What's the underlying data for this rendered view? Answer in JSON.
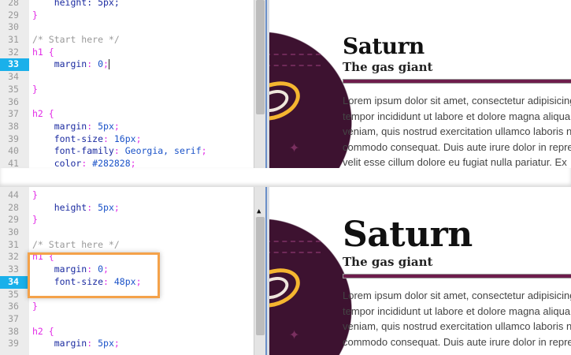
{
  "top": {
    "lines": [
      {
        "num": "28",
        "tokens": [
          {
            "t": "    height: 5px;",
            "c": "prop"
          }
        ]
      },
      {
        "num": "29",
        "tokens": [
          {
            "t": "}",
            "c": "punct"
          }
        ]
      },
      {
        "num": "30",
        "tokens": []
      },
      {
        "num": "31",
        "tokens": [
          {
            "t": "/* Start here */",
            "c": "com"
          }
        ]
      },
      {
        "num": "32",
        "tokens": [
          {
            "t": "h1 {",
            "c": "sel"
          }
        ]
      },
      {
        "num": "33",
        "active": true,
        "caret": true,
        "tokens": [
          {
            "t": "    margin",
            "c": "prop"
          },
          {
            "t": ": ",
            "c": "punct"
          },
          {
            "t": "0",
            "c": "val"
          },
          {
            "t": ";",
            "c": "punct"
          }
        ]
      },
      {
        "num": "34",
        "tokens": []
      },
      {
        "num": "35",
        "tokens": [
          {
            "t": "}",
            "c": "punct"
          }
        ]
      },
      {
        "num": "36",
        "tokens": []
      },
      {
        "num": "37",
        "tokens": [
          {
            "t": "h2 {",
            "c": "sel"
          }
        ]
      },
      {
        "num": "38",
        "tokens": [
          {
            "t": "    margin",
            "c": "prop"
          },
          {
            "t": ": ",
            "c": "punct"
          },
          {
            "t": "5px",
            "c": "val"
          },
          {
            "t": ";",
            "c": "punct"
          }
        ]
      },
      {
        "num": "39",
        "tokens": [
          {
            "t": "    font-size",
            "c": "prop"
          },
          {
            "t": ": ",
            "c": "punct"
          },
          {
            "t": "16px",
            "c": "val"
          },
          {
            "t": ";",
            "c": "punct"
          }
        ]
      },
      {
        "num": "40",
        "tokens": [
          {
            "t": "    font-family",
            "c": "prop"
          },
          {
            "t": ": ",
            "c": "punct"
          },
          {
            "t": "Georgia, serif",
            "c": "val"
          },
          {
            "t": ";",
            "c": "punct"
          }
        ]
      },
      {
        "num": "41",
        "tokens": [
          {
            "t": "    color",
            "c": "prop"
          },
          {
            "t": ": ",
            "c": "punct"
          },
          {
            "t": "#282828",
            "c": "val"
          },
          {
            "t": ";",
            "c": "punct"
          }
        ]
      }
    ]
  },
  "bottom": {
    "lines": [
      {
        "num": "44",
        "tokens": [
          {
            "t": "}",
            "c": "punct"
          }
        ]
      },
      {
        "num": "28",
        "tokens": [
          {
            "t": "    height",
            "c": "prop"
          },
          {
            "t": ": ",
            "c": "punct"
          },
          {
            "t": "5px",
            "c": "val"
          },
          {
            "t": ";",
            "c": "punct"
          }
        ]
      },
      {
        "num": "29",
        "tokens": [
          {
            "t": "}",
            "c": "punct"
          }
        ]
      },
      {
        "num": "30",
        "tokens": []
      },
      {
        "num": "31",
        "tokens": [
          {
            "t": "/* Start here */",
            "c": "com"
          }
        ]
      },
      {
        "num": "32",
        "tokens": [
          {
            "t": "h1 {",
            "c": "sel"
          }
        ]
      },
      {
        "num": "33",
        "tokens": [
          {
            "t": "    margin",
            "c": "prop"
          },
          {
            "t": ": ",
            "c": "punct"
          },
          {
            "t": "0",
            "c": "val"
          },
          {
            "t": ";",
            "c": "punct"
          }
        ]
      },
      {
        "num": "34",
        "active": true,
        "tokens": [
          {
            "t": "    font-size",
            "c": "prop"
          },
          {
            "t": ": ",
            "c": "punct"
          },
          {
            "t": "48px",
            "c": "val"
          },
          {
            "t": ";",
            "c": "punct"
          }
        ]
      },
      {
        "num": "35",
        "tokens": []
      },
      {
        "num": "36",
        "tokens": [
          {
            "t": "}",
            "c": "punct"
          }
        ]
      },
      {
        "num": "37",
        "tokens": []
      },
      {
        "num": "38",
        "tokens": [
          {
            "t": "h2 {",
            "c": "sel"
          }
        ]
      },
      {
        "num": "39",
        "tokens": [
          {
            "t": "    margin",
            "c": "prop"
          },
          {
            "t": ": ",
            "c": "punct"
          },
          {
            "t": "5px",
            "c": "val"
          },
          {
            "t": ";",
            "c": "punct"
          }
        ]
      }
    ]
  },
  "preview": {
    "title": "Saturn",
    "subtitle": "The gas giant",
    "paragraph": [
      "Lorem ipsum dolor sit amet, consectetur adipisicing",
      "tempor incididunt ut labore et dolore magna aliqua",
      "veniam, quis nostrud exercitation ullamco laboris n",
      "commodo consequat. Duis aute irure dolor in repre",
      "velit esse cillum dolore eu fugiat nulla pariatur. Ex"
    ]
  },
  "colors": {
    "accent": "#1ab0ea",
    "highlight": "#f4a24a",
    "planet": "#3d1230",
    "bar": "#6e1d4c"
  }
}
